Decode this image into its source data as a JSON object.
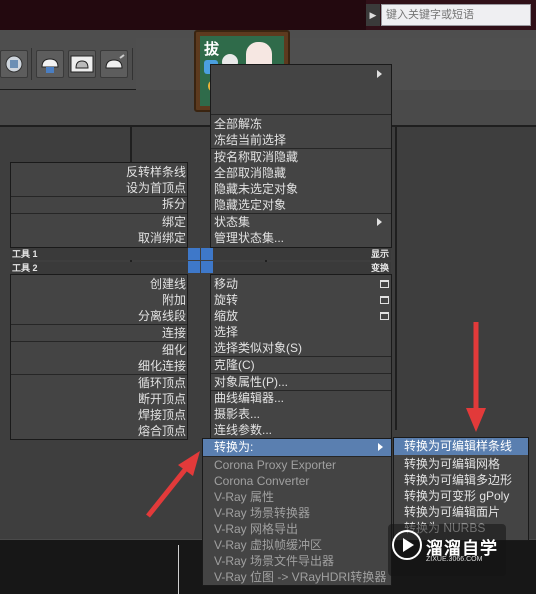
{
  "search": {
    "placeholder": "键入关键字或短语"
  },
  "toolbar": {
    "icons": [
      "render-setup-icon",
      "render-frame-icon",
      "render-teapot-icon",
      "render-production-icon"
    ]
  },
  "sticker": {
    "text": "拔"
  },
  "quad_left": {
    "top_items": [
      "反转样条线",
      "设为首顶点",
      "拆分",
      "绑定",
      "取消绑定"
    ],
    "header1": {
      "left": "工具 1",
      "right": "显示"
    },
    "header2": {
      "left": "工具 2",
      "right": "变换"
    },
    "bottom_items": [
      "创建线",
      "附加",
      "分离线段",
      "连接",
      "细化",
      "细化连接",
      "循环顶点",
      "断开顶点",
      "焊接顶点",
      "熔合顶点"
    ]
  },
  "quad_right": {
    "top_items": [
      "全部解冻",
      "冻结当前选择",
      "按名称取消隐藏",
      "全部取消隐藏",
      "隐藏未选定对象",
      "隐藏选定对象",
      "状态集",
      "管理状态集..."
    ],
    "transform_items": [
      "移动",
      "旋转",
      "缩放",
      "选择",
      "选择类似对象(S)",
      "克隆(C)",
      "对象属性(P)...",
      "曲线编辑器...",
      "摄影表...",
      "连线参数..."
    ],
    "convert_item": "转换为:",
    "plugin_items": [
      "Corona Proxy Exporter",
      "Corona Converter",
      "V-Ray 属性",
      "V-Ray 场景转换器",
      "V-Ray 网格导出",
      "V-Ray 虚拟帧缓冲区",
      "V-Ray 场景文件导出器",
      "V-Ray 位图 -> VRayHDRI转换器"
    ]
  },
  "submenu": {
    "items": [
      "转换为可编辑样条线",
      "转换为可编辑网格",
      "转换为可编辑多边形",
      "转换为可变形 gPoly",
      "转换为可编辑面片",
      "转换为 NURBS"
    ]
  },
  "watermark": {
    "title": "溜溜自学",
    "url": "ZIXUE.3066.COM"
  },
  "colors": {
    "highlight": "#5a7fb0",
    "annotation_arrow": "#e23a3a",
    "menu_bg": "#444444"
  }
}
